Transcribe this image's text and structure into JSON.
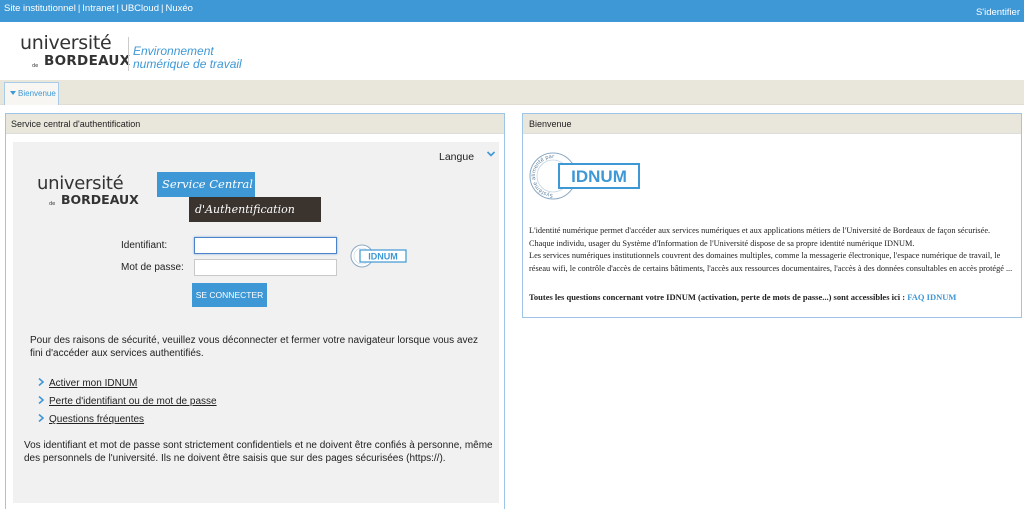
{
  "topbar": {
    "links": [
      "Site institutionnel",
      "Intranet",
      "UBCloud",
      "Nuxéo"
    ],
    "login": "S'identifier"
  },
  "header": {
    "logo_line1": "université",
    "logo_de": "de",
    "logo_line2": "BORDEAUX",
    "ent_line1": "Environnement",
    "ent_line2": "numérique de travail"
  },
  "nav": {
    "tab": "Bienvenue"
  },
  "left_panel": {
    "title": "Service central d'authentification",
    "language": "Langue",
    "cas_logo_line1": "université",
    "cas_logo_de": "de",
    "cas_logo_line2": "BORDEAUX",
    "banner_service": "Service Central",
    "banner_auth": "d'Authentification",
    "id_label": "Identifiant:",
    "pw_label": "Mot de passe:",
    "login_button": "SE CONNECTER",
    "security_text": "Pour des raisons de sécurité, veuillez vous déconnecter et fermer votre navigateur lorsque vous avez fini d'accéder aux services authentifiés.",
    "links": [
      "Activer mon IDNUM",
      "Perte d'identifiant ou de mot de passe",
      "Questions fréquentes"
    ],
    "confidential_text": "Vos identifiant et mot de passe sont strictement confidentiels et ne doivent être confiés à personne, même des personnels de l'université. Ils ne doivent être saisis que sur des pages sécurisées (https://)."
  },
  "right_panel": {
    "title": "Bienvenue",
    "badge_small": "IDNUM",
    "badge_big": "IDNUM",
    "badge_ring": "Système alimenté par",
    "welcome_line1": "L'identité numérique permet d'accéder aux services numériques et aux applications métiers de l'Université de Bordeaux de façon sécurisée.",
    "welcome_line2": "Chaque individu, usager du Système d'Information de l'Université dispose de sa propre identité numérique IDNUM.",
    "welcome_line3": "Les services numériques institutionnels couvrent des domaines multiples, comme la messagerie électronique, l'espace numérique de travail, le réseau wifi, le contrôle d'accès de certains bâtiments, l'accès aux ressources documentaires, l'accès à des données consultables en accès protégé ...",
    "faq_text": "Toutes les questions concernant votre IDNUM (activation, perte de mots de passe...) sont accessibles ici :",
    "faq_link": "FAQ IDNUM"
  },
  "colors": {
    "accent": "#3f98d6",
    "dark_banner": "#3a332e",
    "nav_bg": "#e9e6dc"
  }
}
